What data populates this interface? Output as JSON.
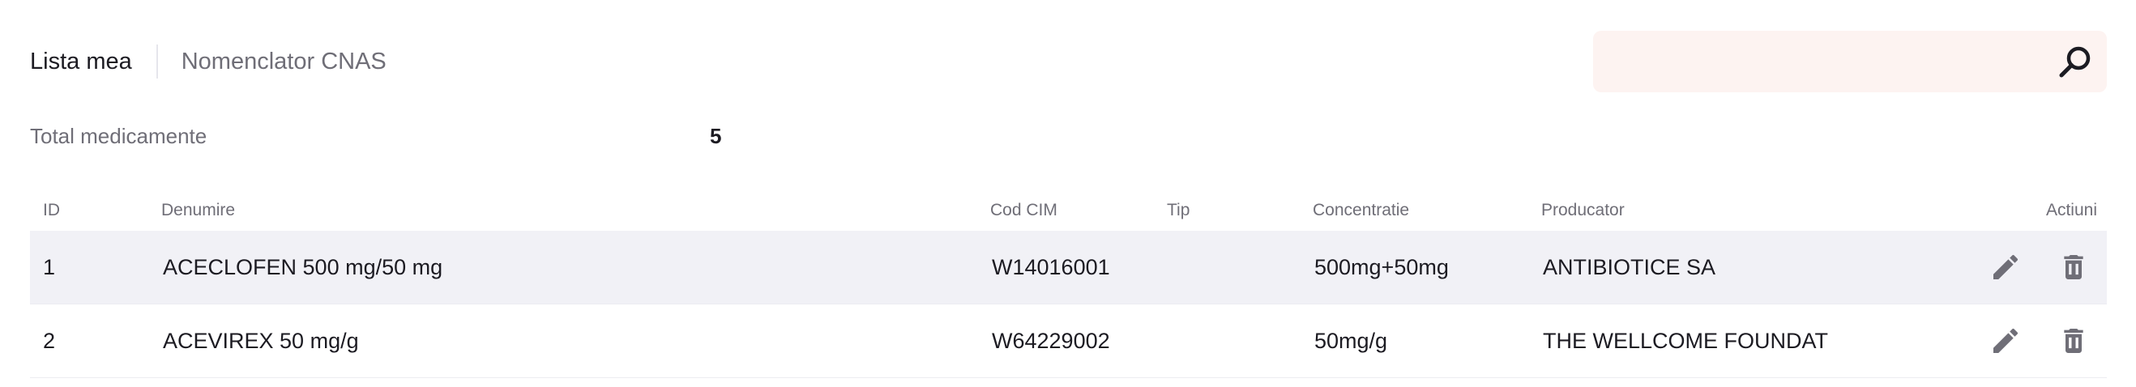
{
  "tabs": [
    {
      "label": "Lista mea",
      "active": true
    },
    {
      "label": "Nomenclator CNAS",
      "active": false
    }
  ],
  "search": {
    "value": "",
    "placeholder": "",
    "icon": "search-icon"
  },
  "summary": {
    "label": "Total medicamente",
    "value": "5"
  },
  "table": {
    "columns": {
      "id": "ID",
      "name": "Denumire",
      "cim": "Cod CIM",
      "type": "Tip",
      "conc": "Concentratie",
      "producer": "Producator",
      "actions": "Actiuni"
    },
    "rows": [
      {
        "id": "1",
        "name": "ACECLOFEN 500 mg/50 mg",
        "cim": "W14016001",
        "type": "",
        "conc": "500mg+50mg",
        "producer": "ANTIBIOTICE SA"
      },
      {
        "id": "2",
        "name": "ACEVIREX 50 mg/g",
        "cim": "W64229002",
        "type": "",
        "conc": "50mg/g",
        "producer": "THE WELLCOME FOUNDAT"
      }
    ],
    "row_icons": {
      "edit": "pencil-icon",
      "delete": "trash-icon"
    }
  },
  "colors": {
    "text": "#1c1b22",
    "muted": "#6f6e77",
    "row_highlight": "#f1f1f6",
    "search_bg": "#fdf3f1",
    "icon": "#6f6e77"
  }
}
